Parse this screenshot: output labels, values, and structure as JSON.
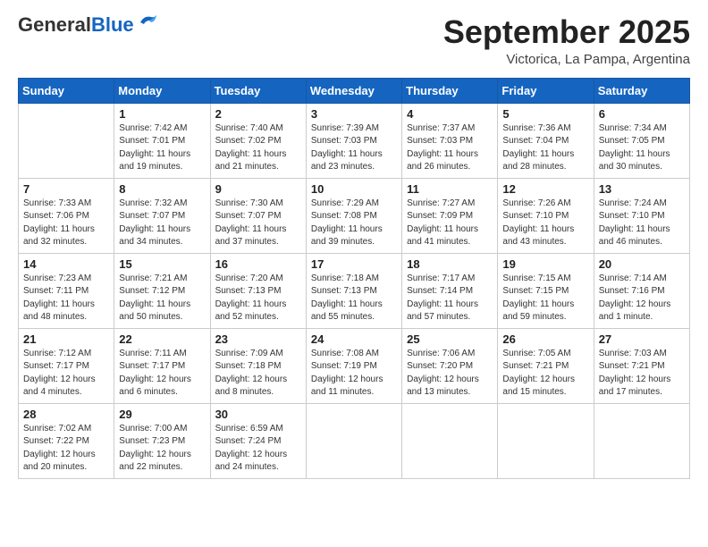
{
  "header": {
    "logo_general": "General",
    "logo_blue": "Blue",
    "month_title": "September 2025",
    "location": "Victorica, La Pampa, Argentina"
  },
  "weekdays": [
    "Sunday",
    "Monday",
    "Tuesday",
    "Wednesday",
    "Thursday",
    "Friday",
    "Saturday"
  ],
  "weeks": [
    [
      {
        "day": "",
        "info": ""
      },
      {
        "day": "1",
        "info": "Sunrise: 7:42 AM\nSunset: 7:01 PM\nDaylight: 11 hours\nand 19 minutes."
      },
      {
        "day": "2",
        "info": "Sunrise: 7:40 AM\nSunset: 7:02 PM\nDaylight: 11 hours\nand 21 minutes."
      },
      {
        "day": "3",
        "info": "Sunrise: 7:39 AM\nSunset: 7:03 PM\nDaylight: 11 hours\nand 23 minutes."
      },
      {
        "day": "4",
        "info": "Sunrise: 7:37 AM\nSunset: 7:03 PM\nDaylight: 11 hours\nand 26 minutes."
      },
      {
        "day": "5",
        "info": "Sunrise: 7:36 AM\nSunset: 7:04 PM\nDaylight: 11 hours\nand 28 minutes."
      },
      {
        "day": "6",
        "info": "Sunrise: 7:34 AM\nSunset: 7:05 PM\nDaylight: 11 hours\nand 30 minutes."
      }
    ],
    [
      {
        "day": "7",
        "info": "Sunrise: 7:33 AM\nSunset: 7:06 PM\nDaylight: 11 hours\nand 32 minutes."
      },
      {
        "day": "8",
        "info": "Sunrise: 7:32 AM\nSunset: 7:07 PM\nDaylight: 11 hours\nand 34 minutes."
      },
      {
        "day": "9",
        "info": "Sunrise: 7:30 AM\nSunset: 7:07 PM\nDaylight: 11 hours\nand 37 minutes."
      },
      {
        "day": "10",
        "info": "Sunrise: 7:29 AM\nSunset: 7:08 PM\nDaylight: 11 hours\nand 39 minutes."
      },
      {
        "day": "11",
        "info": "Sunrise: 7:27 AM\nSunset: 7:09 PM\nDaylight: 11 hours\nand 41 minutes."
      },
      {
        "day": "12",
        "info": "Sunrise: 7:26 AM\nSunset: 7:10 PM\nDaylight: 11 hours\nand 43 minutes."
      },
      {
        "day": "13",
        "info": "Sunrise: 7:24 AM\nSunset: 7:10 PM\nDaylight: 11 hours\nand 46 minutes."
      }
    ],
    [
      {
        "day": "14",
        "info": "Sunrise: 7:23 AM\nSunset: 7:11 PM\nDaylight: 11 hours\nand 48 minutes."
      },
      {
        "day": "15",
        "info": "Sunrise: 7:21 AM\nSunset: 7:12 PM\nDaylight: 11 hours\nand 50 minutes."
      },
      {
        "day": "16",
        "info": "Sunrise: 7:20 AM\nSunset: 7:13 PM\nDaylight: 11 hours\nand 52 minutes."
      },
      {
        "day": "17",
        "info": "Sunrise: 7:18 AM\nSunset: 7:13 PM\nDaylight: 11 hours\nand 55 minutes."
      },
      {
        "day": "18",
        "info": "Sunrise: 7:17 AM\nSunset: 7:14 PM\nDaylight: 11 hours\nand 57 minutes."
      },
      {
        "day": "19",
        "info": "Sunrise: 7:15 AM\nSunset: 7:15 PM\nDaylight: 11 hours\nand 59 minutes."
      },
      {
        "day": "20",
        "info": "Sunrise: 7:14 AM\nSunset: 7:16 PM\nDaylight: 12 hours\nand 1 minute."
      }
    ],
    [
      {
        "day": "21",
        "info": "Sunrise: 7:12 AM\nSunset: 7:17 PM\nDaylight: 12 hours\nand 4 minutes."
      },
      {
        "day": "22",
        "info": "Sunrise: 7:11 AM\nSunset: 7:17 PM\nDaylight: 12 hours\nand 6 minutes."
      },
      {
        "day": "23",
        "info": "Sunrise: 7:09 AM\nSunset: 7:18 PM\nDaylight: 12 hours\nand 8 minutes."
      },
      {
        "day": "24",
        "info": "Sunrise: 7:08 AM\nSunset: 7:19 PM\nDaylight: 12 hours\nand 11 minutes."
      },
      {
        "day": "25",
        "info": "Sunrise: 7:06 AM\nSunset: 7:20 PM\nDaylight: 12 hours\nand 13 minutes."
      },
      {
        "day": "26",
        "info": "Sunrise: 7:05 AM\nSunset: 7:21 PM\nDaylight: 12 hours\nand 15 minutes."
      },
      {
        "day": "27",
        "info": "Sunrise: 7:03 AM\nSunset: 7:21 PM\nDaylight: 12 hours\nand 17 minutes."
      }
    ],
    [
      {
        "day": "28",
        "info": "Sunrise: 7:02 AM\nSunset: 7:22 PM\nDaylight: 12 hours\nand 20 minutes."
      },
      {
        "day": "29",
        "info": "Sunrise: 7:00 AM\nSunset: 7:23 PM\nDaylight: 12 hours\nand 22 minutes."
      },
      {
        "day": "30",
        "info": "Sunrise: 6:59 AM\nSunset: 7:24 PM\nDaylight: 12 hours\nand 24 minutes."
      },
      {
        "day": "",
        "info": ""
      },
      {
        "day": "",
        "info": ""
      },
      {
        "day": "",
        "info": ""
      },
      {
        "day": "",
        "info": ""
      }
    ]
  ]
}
